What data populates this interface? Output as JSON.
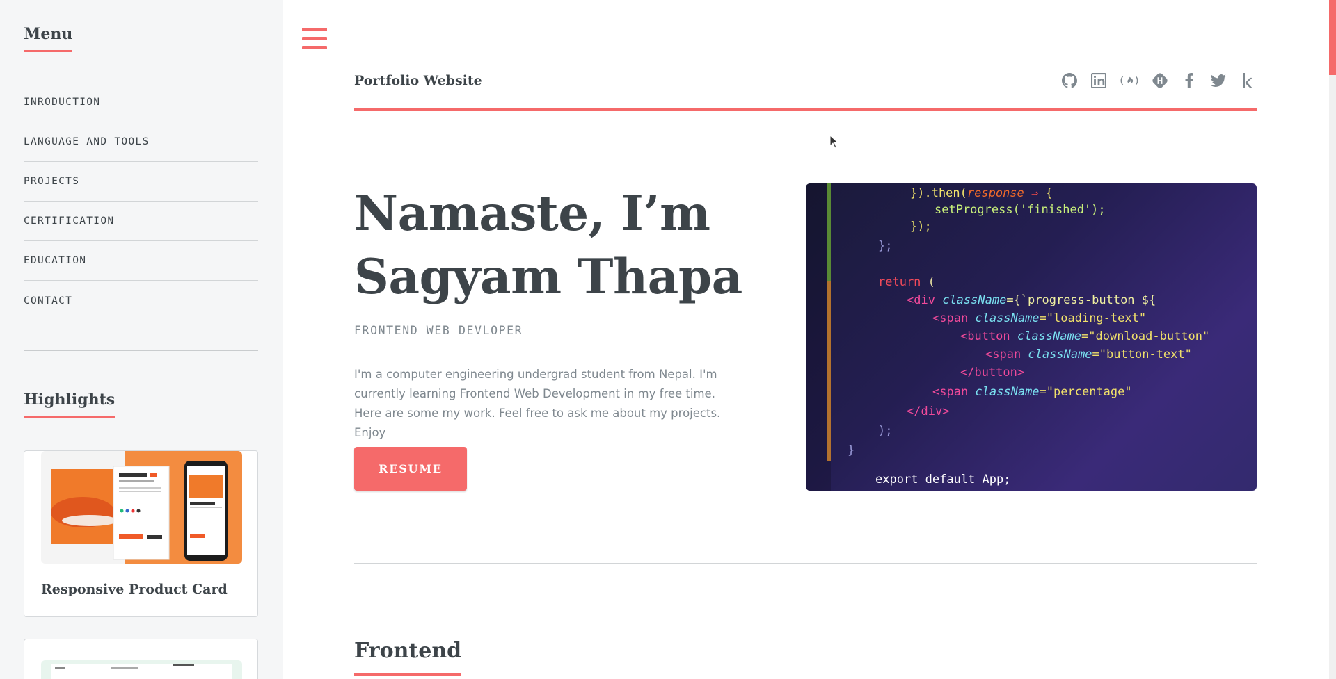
{
  "sidebar": {
    "menu_heading": "Menu",
    "menu_items": [
      {
        "label": "INRODUCTION"
      },
      {
        "label": "LANGUAGE AND TOOLS"
      },
      {
        "label": "PROJECTS"
      },
      {
        "label": "CERTIFICATION"
      },
      {
        "label": "EDUCATION"
      },
      {
        "label": "CONTACT"
      }
    ],
    "highlights_heading": "Highlights",
    "highlights": [
      {
        "title": "Responsive Product Card"
      },
      {
        "title": ""
      }
    ]
  },
  "header": {
    "logo": "Portfolio Website",
    "social_icons": [
      "github-icon",
      "linkedin-icon",
      "freecodecamp-icon",
      "hashnode-icon",
      "facebook-icon",
      "twitter-icon",
      "kaggle-icon"
    ]
  },
  "hero": {
    "title_line1": "Namaste, I’m",
    "title_line2": "Sagyam Thapa",
    "subtitle": "FRONTEND WEB DEVLOPER",
    "description": "I'm a computer engineering undergrad student from Nepal. I'm currently learning Frontend Web Development in my free time. Here are some my work. Feel free to ask me about my projects. Enjoy",
    "button_label": "RESUME"
  },
  "section": {
    "heading": "Frontend"
  },
  "colors": {
    "accent": "#f56a6a",
    "text": "#3d4449",
    "muted": "#7f888f",
    "sidebar_bg": "#f5f6f7"
  }
}
